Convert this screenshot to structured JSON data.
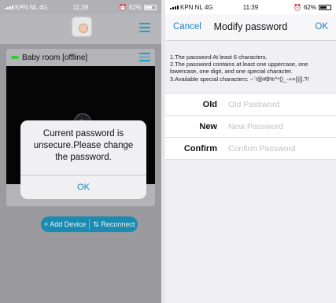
{
  "left": {
    "status": {
      "carrier": "KPN NL 4G",
      "time": "11:39",
      "battery": "62%"
    },
    "card": {
      "title": "Baby room [offline]"
    },
    "buttons": {
      "add_device": "+ Add Device",
      "reconnect": "Reconnect"
    },
    "alert": {
      "message": "Current password is unsecure.Please change the password.",
      "ok": "OK"
    },
    "colors": {
      "accent": "#1e7ec8",
      "online_dot": "#3fc83f",
      "button_bg": "#1b8bb0"
    }
  },
  "right": {
    "status": {
      "carrier": "KPN NL 4G",
      "time": "11:39",
      "battery": "62%"
    },
    "nav": {
      "cancel": "Cancel",
      "title": "Modify password",
      "ok": "OK"
    },
    "rules": [
      "1.The password At least 6 characters.",
      "2.The password contains at least one uppercase, one",
      "lowercase, one digit, and one special character.",
      "3.Available special characters: ~`!@#$%^*()_-+={}[].?/"
    ],
    "fields": [
      {
        "label": "Old",
        "placeholder": "Old Password"
      },
      {
        "label": "New",
        "placeholder": "New Password"
      },
      {
        "label": "Confirm",
        "placeholder": "Confirm Password"
      }
    ]
  }
}
